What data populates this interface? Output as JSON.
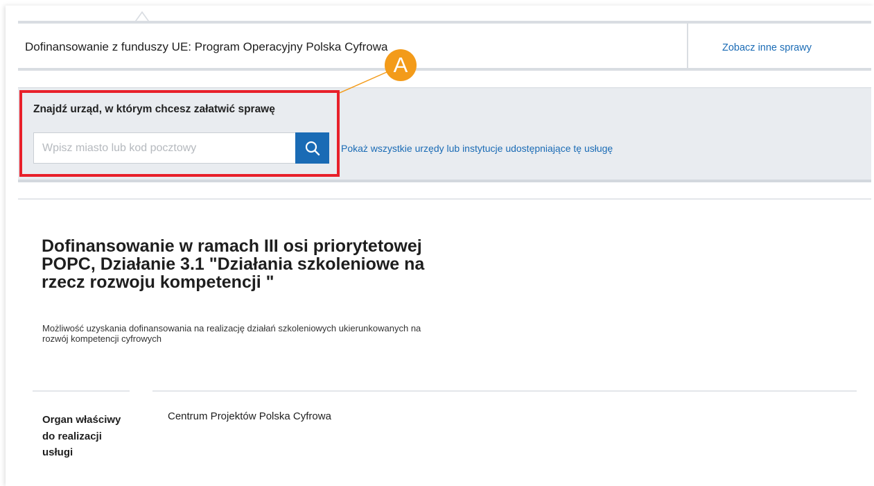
{
  "case_bar": {
    "title": "Dofinansowanie z funduszy UE: Program Operacyjny Polska Cyfrowa",
    "other_cases_link": "Zobacz inne sprawy"
  },
  "search": {
    "label": "Znajdź urząd, w którym chcesz załatwić sprawę",
    "placeholder": "Wpisz miasto lub kod pocztowy",
    "button_icon": "search-icon",
    "all_offices_link": "Pokaż wszystkie urzędy lub instytucje udostępniające tę usługę"
  },
  "annotation": {
    "marker_label": "A",
    "highlight_color": "#e8202a",
    "marker_color": "#f39b1a"
  },
  "service": {
    "title": "Dofinansowanie w ramach III osi priorytetowej POPC, Działanie 3.1 \"Działania szkoleniowe na rzecz rozwoju kompetencji \"",
    "description": "Możliwość uzyskania dofinansowania na realizację działań szkoleniowych ukierunkowanych na rozwój kompetencji cyfrowych"
  },
  "details": [
    {
      "label": "Organ właściwy do realizacji usługi",
      "value": "Centrum Projektów Polska Cyfrowa"
    }
  ],
  "colors": {
    "accent_blue": "#1a6bb5",
    "band_gray": "#e9ecf0"
  }
}
